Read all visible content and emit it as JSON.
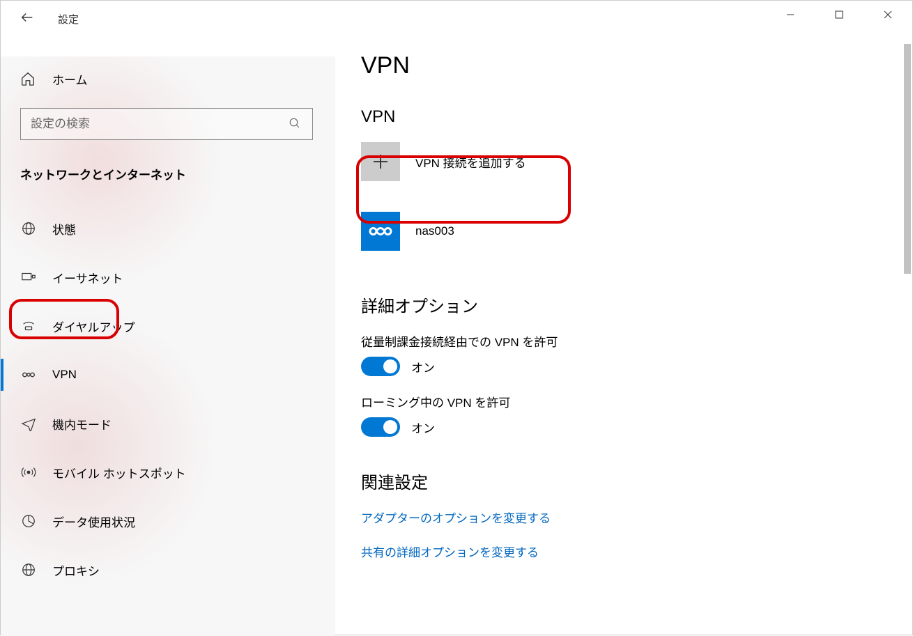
{
  "app_title": "設定",
  "window": {
    "minimize": "—",
    "maximize": "☐",
    "close": "✕"
  },
  "sidebar": {
    "home": "ホーム",
    "search_placeholder": "設定の検索",
    "category": "ネットワークとインターネット",
    "items": [
      {
        "label": "状態",
        "icon": "network-status-icon"
      },
      {
        "label": "イーサネット",
        "icon": "ethernet-icon"
      },
      {
        "label": "ダイヤルアップ",
        "icon": "dialup-icon"
      },
      {
        "label": "VPN",
        "icon": "vpn-icon"
      },
      {
        "label": "機内モード",
        "icon": "airplane-icon"
      },
      {
        "label": "モバイル ホットスポット",
        "icon": "hotspot-icon"
      },
      {
        "label": "データ使用状況",
        "icon": "data-usage-icon"
      },
      {
        "label": "プロキシ",
        "icon": "proxy-icon"
      }
    ]
  },
  "main": {
    "title": "VPN",
    "section_vpn": "VPN",
    "add_label": "VPN 接続を追加する",
    "connections": [
      {
        "name": "nas003"
      }
    ],
    "section_advanced": "詳細オプション",
    "opts": [
      {
        "label": "従量制課金接続経由での VPN を許可",
        "state": "オン",
        "on": true
      },
      {
        "label": "ローミング中の VPN を許可",
        "state": "オン",
        "on": true
      }
    ],
    "section_related": "関連設定",
    "links": [
      "アダプターのオプションを変更する",
      "共有の詳細オプションを変更する"
    ]
  }
}
